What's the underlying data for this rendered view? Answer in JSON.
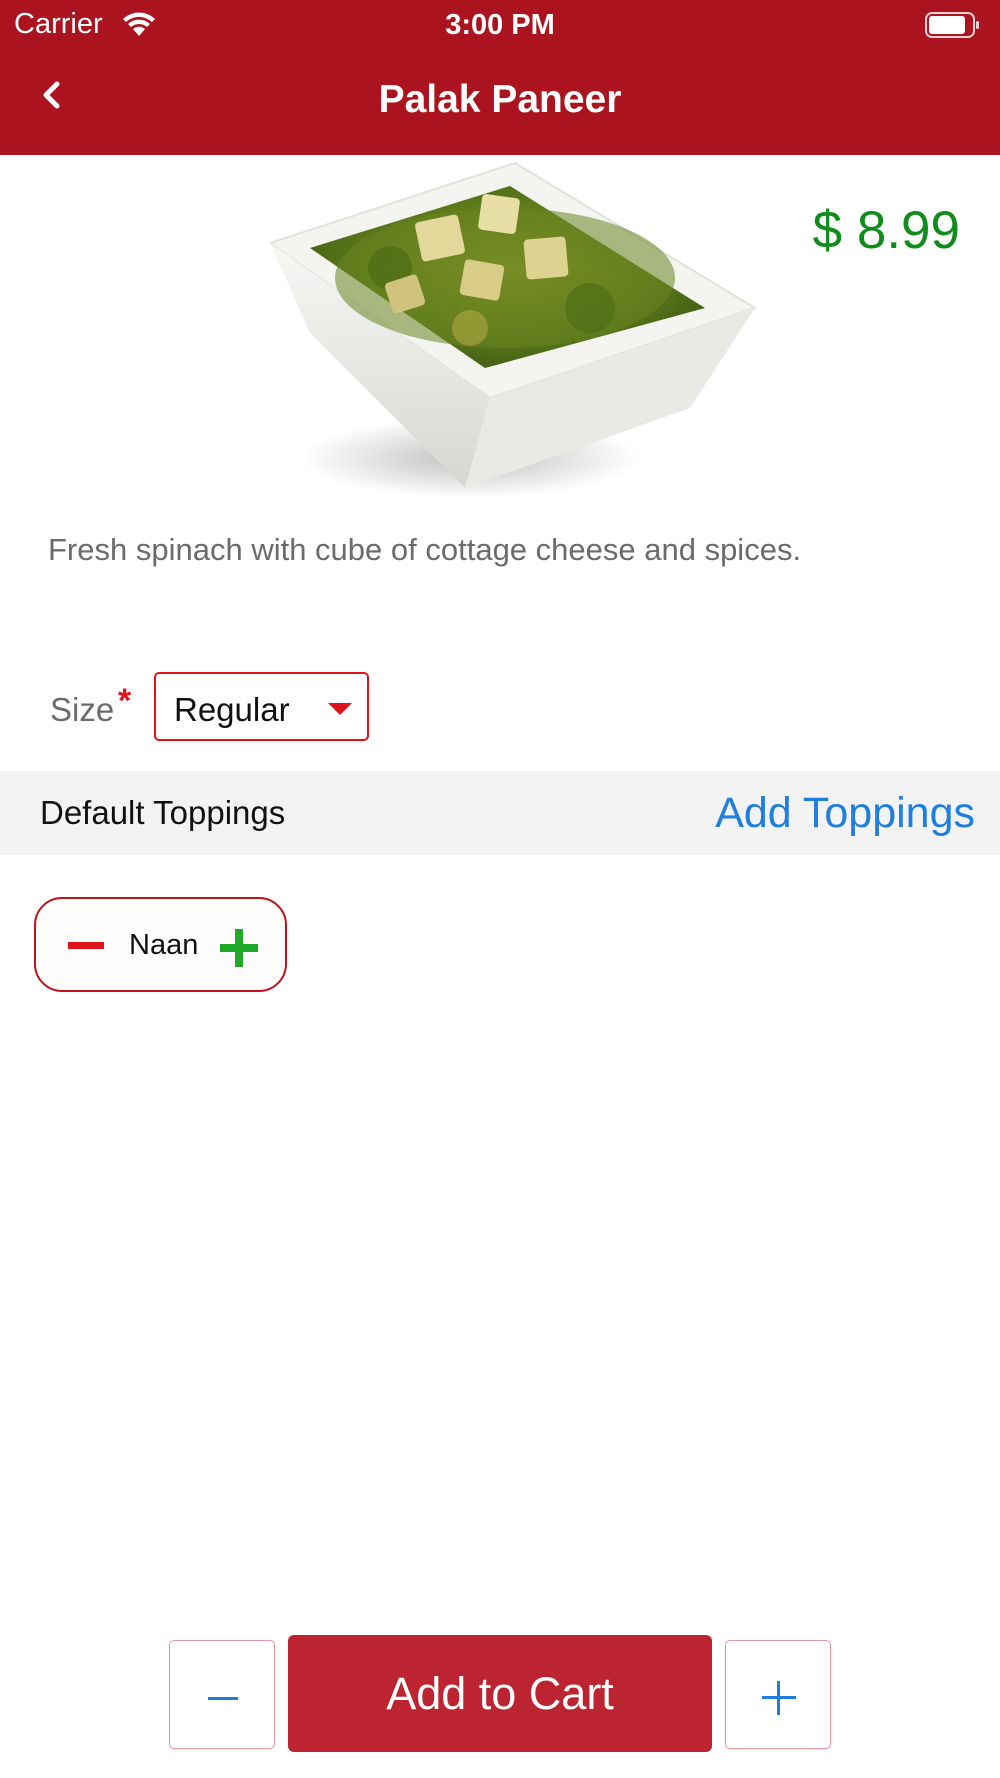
{
  "status_bar": {
    "carrier": "Carrier",
    "time": "3:00 PM",
    "wifi_icon": "wifi-icon",
    "battery_icon": "battery-icon"
  },
  "nav": {
    "title": "Palak Paneer",
    "back_icon": "chevron-left-icon",
    "background_color": "#ab131f"
  },
  "dish": {
    "price": "$ 8.99",
    "price_color": "#0f8c1c",
    "description": "Fresh spinach with cube of cottage cheese and spices.",
    "image_subject": "palak paneer in white square bowl"
  },
  "size": {
    "label": "Size",
    "required_mark": "*",
    "selected": "Regular",
    "caret_icon": "caret-down-icon"
  },
  "toppings": {
    "default_label": "Default Toppings",
    "add_label": "Add Toppings",
    "items": [
      {
        "name": "Naan",
        "remove_icon": "minus-icon",
        "add_icon": "plus-icon"
      }
    ]
  },
  "cart": {
    "add_label": "Add to Cart",
    "decrease_icon": "minus-icon",
    "increase_icon": "plus-icon",
    "button_color": "#bd2432"
  }
}
